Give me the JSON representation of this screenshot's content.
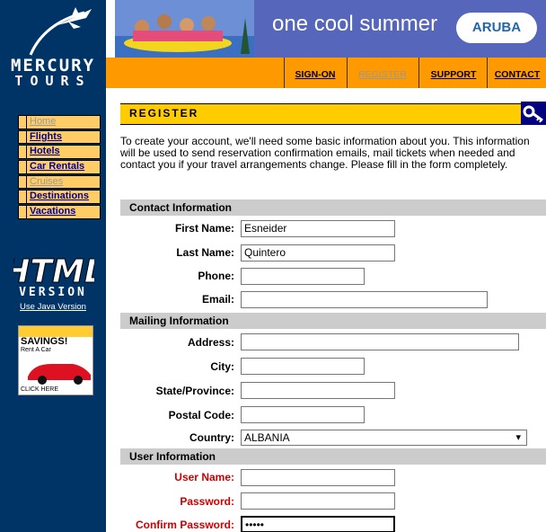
{
  "brand": {
    "name_line1": "MERCURY",
    "name_line2": "TOURS"
  },
  "nav": [
    {
      "label": "Home",
      "style": "home"
    },
    {
      "label": "Flights",
      "style": "link"
    },
    {
      "label": "Hotels",
      "style": "link"
    },
    {
      "label": "Car Rentals",
      "style": "link"
    },
    {
      "label": "Cruises",
      "style": "dim"
    },
    {
      "label": "Destinations",
      "style": "link"
    },
    {
      "label": "Vacations",
      "style": "link"
    }
  ],
  "html_version": {
    "logo": "HTML",
    "version": "VERSION",
    "java_link": "Use Java Version"
  },
  "ad": {
    "title": "SAVINGS!",
    "sub": "Rent A Car",
    "click": "CLICK HERE"
  },
  "banner": {
    "text": "one cool summer",
    "badge": "ARUBA"
  },
  "topnav": {
    "signon": "SIGN-ON",
    "register": "REGISTER",
    "support": "SUPPORT",
    "contact": "CONTACT"
  },
  "page": {
    "title": "REGISTER",
    "intro": "To create your account, we'll need some basic information about you. This information will be used to send reservation confirmation emails, mail tickets when needed and contact you if your travel arrangements change. Please fill in the form completely."
  },
  "form": {
    "contact_section": "Contact Information",
    "first_name_label": "First Name:",
    "first_name_value": "Esneider",
    "last_name_label": "Last Name:",
    "last_name_value": "Quintero",
    "phone_label": "Phone:",
    "phone_value": "",
    "email_label": "Email:",
    "email_value": "",
    "mailing_section": "Mailing Information",
    "address_label": "Address:",
    "address_value": "",
    "city_label": "City:",
    "city_value": "",
    "state_label": "State/Province:",
    "state_value": "",
    "postal_label": "Postal Code:",
    "postal_value": "",
    "country_label": "Country:",
    "country_value": "ALBANIA",
    "user_section": "User Information",
    "username_label": "User Name:",
    "username_value": "",
    "password_label": "Password:",
    "password_value": "",
    "confirm_label": "Confirm Password:",
    "confirm_value": "•••••"
  },
  "colors": {
    "sidebar": "#003366",
    "accent": "#ff9900",
    "header": "#ffcc00",
    "required": "#cc0000"
  }
}
